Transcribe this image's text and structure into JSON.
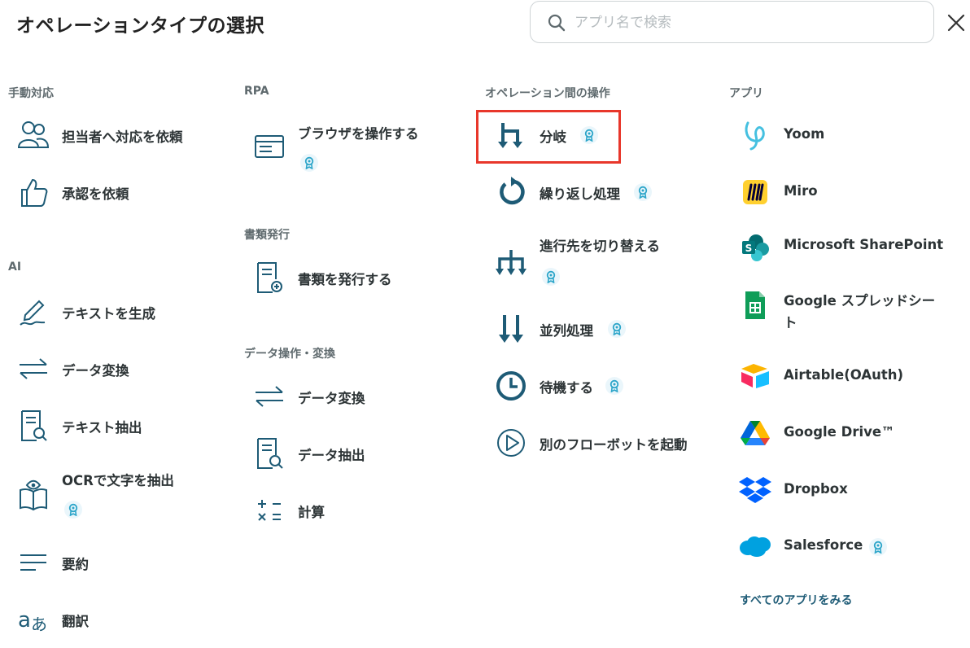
{
  "header": {
    "title": "オペレーションタイプの選択"
  },
  "search": {
    "placeholder": "アプリ名で検索"
  },
  "sections": {
    "manual": "手動対応",
    "ai": "AI",
    "rpa": "RPA",
    "docs": "書類発行",
    "data": "データ操作・変換",
    "ops": "オペレーション間の操作",
    "apps": "アプリ"
  },
  "manual_items": [
    "担当者へ対応を依頼",
    "承認を依頼"
  ],
  "ai_items": [
    "テキストを生成",
    "データ変換",
    "テキスト抽出",
    "OCRで文字を抽出",
    "要約",
    "翻訳"
  ],
  "rpa_items": [
    "ブラウザを操作する"
  ],
  "doc_items": [
    "書類を発行する"
  ],
  "data_items": [
    "データ変換",
    "データ抽出",
    "計算"
  ],
  "op_items": [
    "分岐",
    "繰り返し処理",
    "進行先を切り替える",
    "並列処理",
    "待機する",
    "別のフローボットを起動"
  ],
  "app_items": [
    "Yoom",
    "Miro",
    "Microsoft SharePoint",
    "Google スプレッドシート",
    "Airtable(OAuth)",
    "Google Drive™",
    "Dropbox",
    "Salesforce"
  ],
  "all_apps_link": "すべてのアプリをみる",
  "colors": {
    "primary": "#1e5b76",
    "accent_badge": "#2ca5c9",
    "highlight": "#e8372b",
    "text": "#2d3436"
  }
}
